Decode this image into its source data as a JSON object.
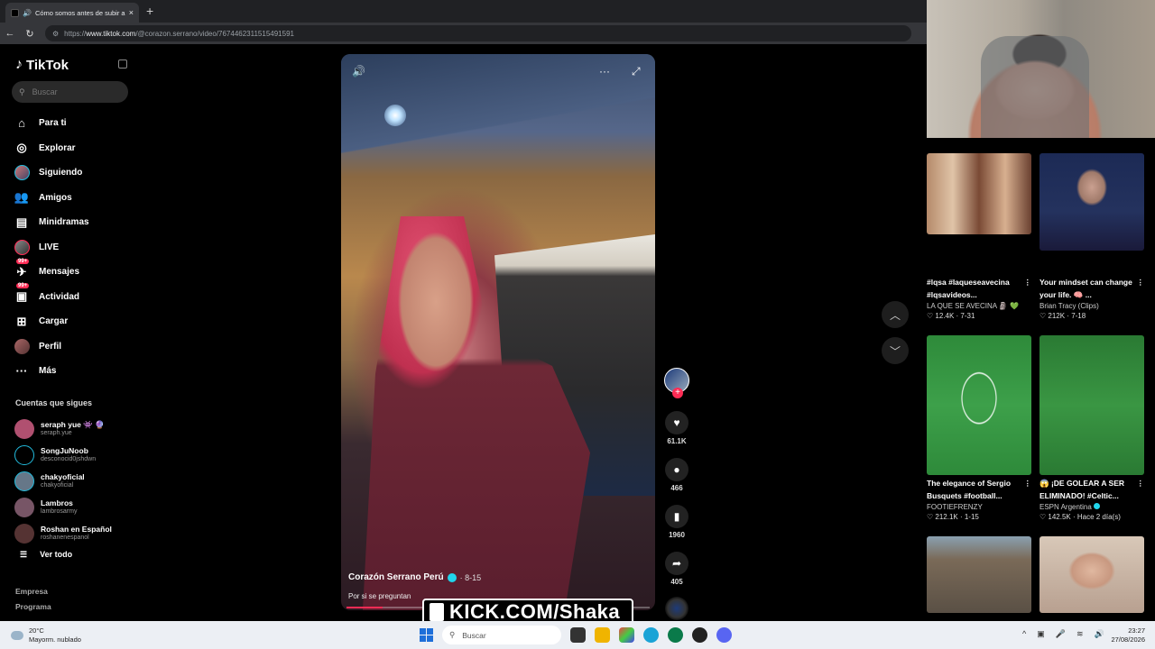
{
  "browser": {
    "tab_title": "Cómo somos antes de subir a",
    "tab_close": "×",
    "new_tab": "+",
    "url_prefix": "https://",
    "url_host": "www.tiktok.com",
    "url_path": "/@corazon.serrano/video/7674462311515491591"
  },
  "sidebar": {
    "logo": "TikTok",
    "search_placeholder": "Buscar",
    "menu": [
      {
        "label": "Para ti",
        "icon": "home-icon"
      },
      {
        "label": "Explorar",
        "icon": "compass-icon"
      },
      {
        "label": "Siguiendo",
        "icon": "following-avatar-icon"
      },
      {
        "label": "Amigos",
        "icon": "friends-icon"
      },
      {
        "label": "Minidramas",
        "icon": "film-icon"
      },
      {
        "label": "LIVE",
        "icon": "live-avatar-icon"
      },
      {
        "label": "Mensajes",
        "icon": "messages-icon",
        "badge": "99+"
      },
      {
        "label": "Actividad",
        "icon": "activity-icon",
        "badge": "99+"
      },
      {
        "label": "Cargar",
        "icon": "upload-icon"
      },
      {
        "label": "Perfil",
        "icon": "profile-avatar-icon"
      },
      {
        "label": "Más",
        "icon": "more-icon"
      }
    ],
    "following_heading": "Cuentas que sigues",
    "following": [
      {
        "name": "seraph yue 👾 🔮",
        "handle": "seraph.yue",
        "color": "#b05070"
      },
      {
        "name": "SongJuNoob",
        "handle": "desconocid0jshdwn",
        "color": "#000000"
      },
      {
        "name": "chakyoficial",
        "handle": "chakyoficial",
        "color": "#667788"
      },
      {
        "name": "Lambros",
        "handle": "lambrosarmy",
        "color": "#775566"
      },
      {
        "name": "Roshan en Español",
        "handle": "roshanenespanol",
        "color": "#553333"
      }
    ],
    "see_all": "Ver todo",
    "footer1": "Empresa",
    "footer2": "Programa"
  },
  "video": {
    "author": "Corazón Serrano Perú",
    "date": "· 8-15",
    "description": "Por si se preguntan",
    "progress": 0.12
  },
  "actions": {
    "likes": "61.1K",
    "comments": "466",
    "saves": "1960",
    "shares": "405"
  },
  "recommendations": [
    {
      "title": "#lqsa #laqueseavecina #lqsavideos...",
      "author": "LA QUE SE AVECINA 🗿 💚",
      "stats": "♡ 12.4K · 7-31"
    },
    {
      "title": "Your mindset can change your life. 🧠 ...",
      "author": "Brian Tracy (Clips)",
      "stats": "♡ 212K · 7-18"
    },
    {
      "title": "The elegance of Sergio Busquets #football...",
      "author": "FOOTIEFRENZY",
      "stats": "♡ 212.1K · 1-15"
    },
    {
      "title": "😱 ¡DE GOLEAR A SER ELIMINADO! #Celtic...",
      "author": "ESPN Argentina",
      "stats": "♡ 142.5K · Hace 2 día(s)"
    }
  ],
  "overlay": {
    "kick": "KICK.COM/Shaka"
  },
  "taskbar": {
    "temp": "20°C",
    "weather": "Mayorm. nublado",
    "search": "Buscar",
    "time": "23:27",
    "date": "27/08/2026"
  }
}
